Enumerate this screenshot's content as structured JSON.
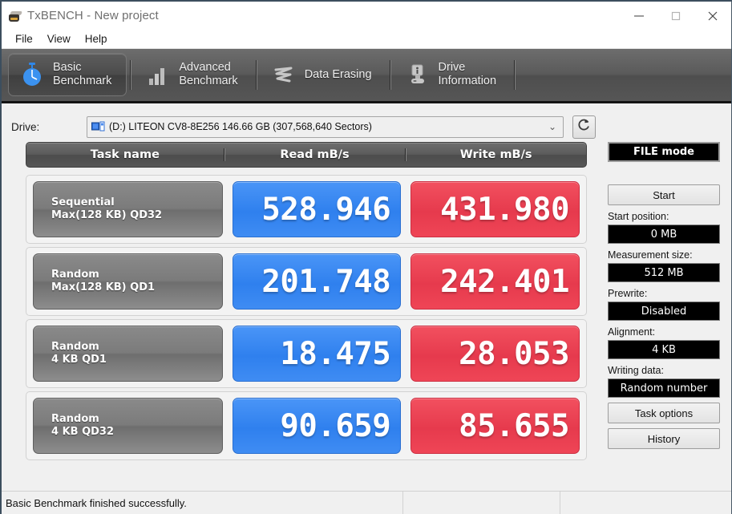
{
  "window": {
    "title": "TxBENCH - New project",
    "app_icon": "scanner-icon",
    "minimize_label": "Minimize",
    "maximize_label": "Maximize",
    "close_label": "Close"
  },
  "menu": {
    "items": [
      {
        "label": "File"
      },
      {
        "label": "View"
      },
      {
        "label": "Help"
      }
    ]
  },
  "tabs": [
    {
      "label": "Basic\nBenchmark",
      "icon": "stopwatch-icon",
      "active": true
    },
    {
      "label": "Advanced\nBenchmark",
      "icon": "bar-chart-icon",
      "active": false
    },
    {
      "label": "Data Erasing",
      "icon": "scribble-erase-icon",
      "active": false
    },
    {
      "label": "Drive\nInformation",
      "icon": "drive-info-icon",
      "active": false
    }
  ],
  "drive": {
    "label": "Drive:",
    "selected": "(D:) LITEON CV8-8E256  146.66 GB (307,568,640 Sectors)",
    "disk_icon": "disk-drive-icon",
    "caret_icon": "chevron-down-icon",
    "refresh_icon": "refresh-icon"
  },
  "table": {
    "headers": {
      "task": "Task name",
      "read": "Read mB/s",
      "write": "Write mB/s"
    },
    "rows": [
      {
        "name_line1": "Sequential",
        "name_line2": "Max(128 KB) QD32",
        "read": "528.946",
        "write": "431.980"
      },
      {
        "name_line1": "Random",
        "name_line2": "Max(128 KB) QD1",
        "read": "201.748",
        "write": "242.401"
      },
      {
        "name_line1": "Random",
        "name_line2": "4 KB QD1",
        "read": "18.475",
        "write": "28.053"
      },
      {
        "name_line1": "Random",
        "name_line2": "4 KB QD32",
        "read": "90.659",
        "write": "85.655"
      }
    ]
  },
  "sidebar": {
    "mode": "FILE mode",
    "start": "Start",
    "start_position_label": "Start position:",
    "start_position_value": "0 MB",
    "measurement_size_label": "Measurement size:",
    "measurement_size_value": "512 MB",
    "prewrite_label": "Prewrite:",
    "prewrite_value": "Disabled",
    "alignment_label": "Alignment:",
    "alignment_value": "4 KB",
    "writing_data_label": "Writing data:",
    "writing_data_value": "Random number",
    "task_options": "Task options",
    "history": "History"
  },
  "status": {
    "message": "Basic Benchmark finished successfully.",
    "pane2": "",
    "pane3": ""
  },
  "colors": {
    "read_blue": "#3f8cf3",
    "write_red": "#ef4556",
    "toolbar_gray": "#565656",
    "panel_bg": "#f0f0f0"
  }
}
